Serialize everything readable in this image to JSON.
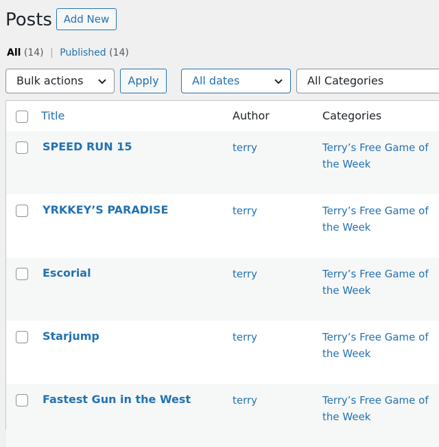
{
  "header": {
    "title": "Posts",
    "add_new_label": "Add New"
  },
  "views": {
    "all_label": "All",
    "all_count": "(14)",
    "separator": "|",
    "published_label": "Published",
    "published_count": "(14)"
  },
  "filters": {
    "bulk_actions": "Bulk actions",
    "apply_label": "Apply",
    "dates": "All dates",
    "categories": "All Categories"
  },
  "table": {
    "columns": {
      "title": "Title",
      "author": "Author",
      "categories": "Categories"
    },
    "rows": [
      {
        "title": "SPEED RUN 15",
        "author": "terry",
        "category": "Terry’s Free Game of the Week"
      },
      {
        "title": "YRKKEY’S PARADISE",
        "author": "terry",
        "category": "Terry’s Free Game of the Week"
      },
      {
        "title": "Escorial",
        "author": "terry",
        "category": "Terry’s Free Game of the Week"
      },
      {
        "title": "Starjump",
        "author": "terry",
        "category": "Terry’s Free Game of the Week"
      },
      {
        "title": "Fastest Gun in the West",
        "author": "terry",
        "category": "Terry’s Free Game of the Week"
      }
    ]
  },
  "icons": {
    "dropdown": "chevron-down-icon",
    "checkbox": "checkbox"
  },
  "colors": {
    "link": "#2271b1",
    "text": "#1d2327",
    "background": "#f0f0f1",
    "row_alt": "#f6f7f7"
  }
}
